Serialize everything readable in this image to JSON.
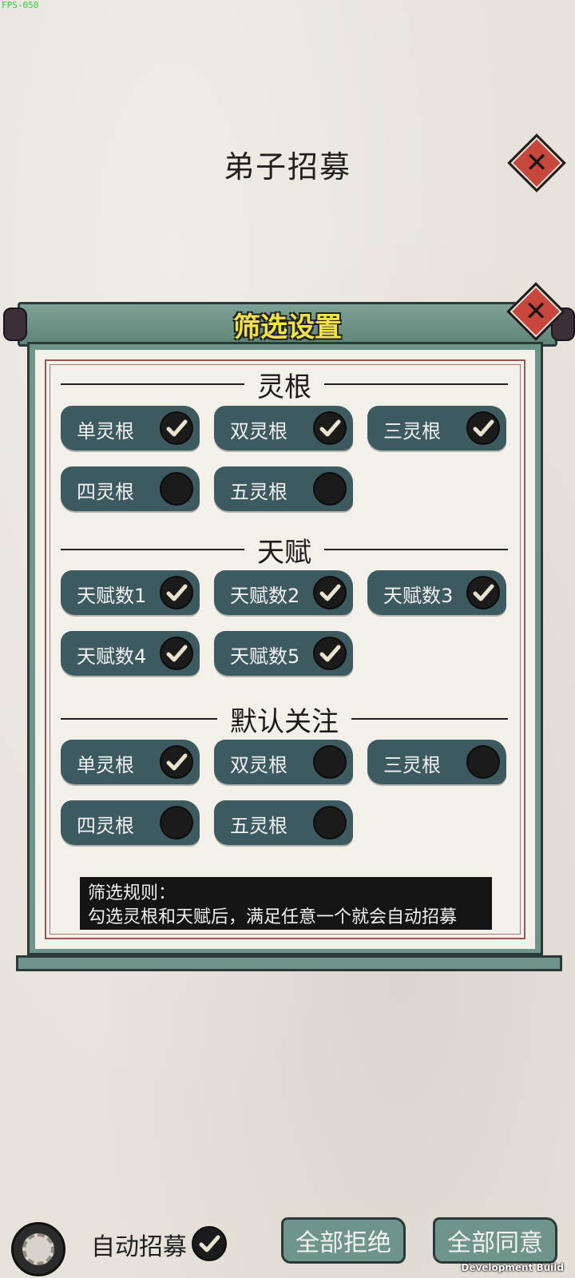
{
  "debug": {
    "fps": "FPS-050",
    "build": "Development Build"
  },
  "page": {
    "title": "弟子招募"
  },
  "panel": {
    "title": "筛选设置",
    "sections": [
      {
        "header": "灵根",
        "options": [
          {
            "label": "单灵根",
            "checked": true
          },
          {
            "label": "双灵根",
            "checked": true
          },
          {
            "label": "三灵根",
            "checked": true
          },
          {
            "label": "四灵根",
            "checked": false
          },
          {
            "label": "五灵根",
            "checked": false
          }
        ]
      },
      {
        "header": "天赋",
        "options": [
          {
            "label": "天赋数1",
            "checked": true
          },
          {
            "label": "天赋数2",
            "checked": true
          },
          {
            "label": "天赋数3",
            "checked": true
          },
          {
            "label": "天赋数4",
            "checked": true
          },
          {
            "label": "天赋数5",
            "checked": true
          }
        ]
      },
      {
        "header": "默认关注",
        "options": [
          {
            "label": "单灵根",
            "checked": true
          },
          {
            "label": "双灵根",
            "checked": false
          },
          {
            "label": "三灵根",
            "checked": false
          },
          {
            "label": "四灵根",
            "checked": false
          },
          {
            "label": "五灵根",
            "checked": false
          }
        ]
      }
    ],
    "rules": {
      "title": "筛选规则：",
      "text": "勾选灵根和天赋后，满足任意一个就会自动招募"
    }
  },
  "footer": {
    "auto_label": "自动招募",
    "auto_checked": true,
    "reject_all": "全部拒绝",
    "accept_all": "全部同意"
  },
  "colors": {
    "option_bg": "#3d5a60",
    "panel_teal": "#6f958a",
    "title_yellow": "#f1e24a",
    "close_red": "#c8473d"
  }
}
